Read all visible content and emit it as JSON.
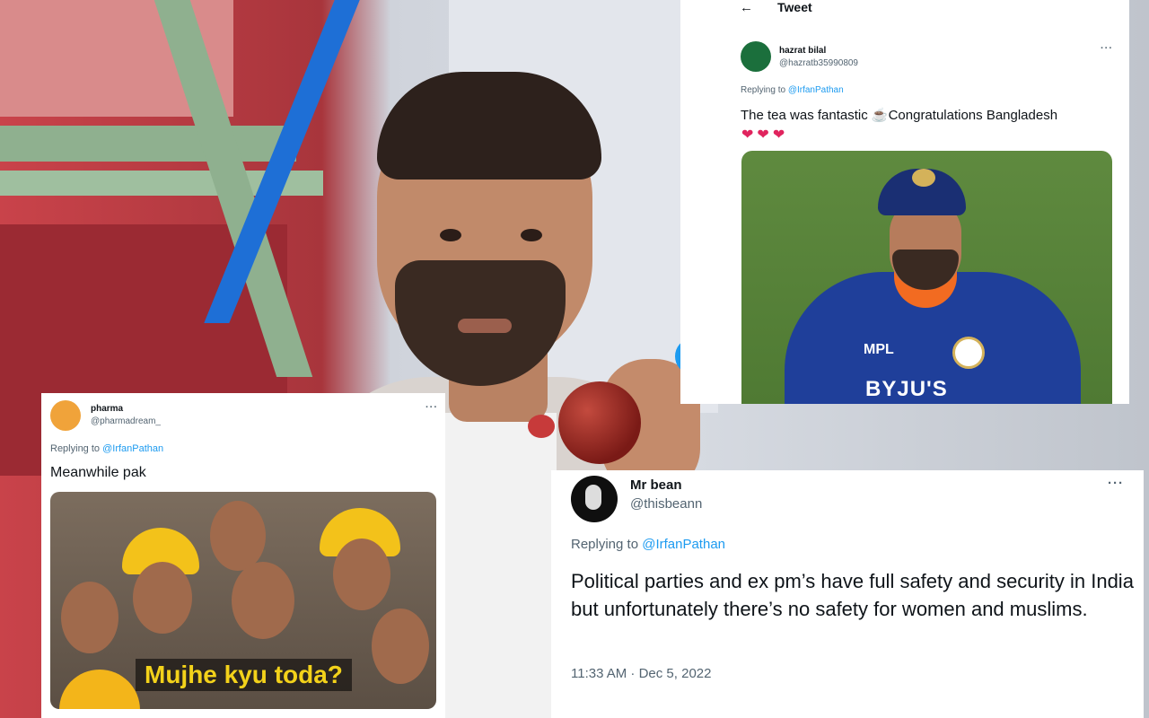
{
  "tweet_top": {
    "back_arrow": "←",
    "header_title": "Tweet",
    "user_name": "hazrat bilal",
    "user_handle": "@hazratb35990809",
    "more": "···",
    "replying_prefix": "Replying to ",
    "replying_mention": "@IrfanPathan",
    "text": "The tea was fantastic ☕Congratulations Bangladesh",
    "hearts": "❤❤❤",
    "media_sponsor_1": "MPL",
    "media_sponsor_2": "BYJU'S"
  },
  "tweet_left": {
    "user_name": "pharma",
    "user_handle": "@pharmadream_",
    "more": "···",
    "replying_prefix": "Replying to ",
    "replying_mention": "@IrfanPathan",
    "text": "Meanwhile pak",
    "media_caption": "Mujhe kyu toda?"
  },
  "tweet_right": {
    "user_name": "Mr bean",
    "user_handle": "@thisbeann",
    "more": "···",
    "replying_prefix": "Replying to ",
    "replying_mention": "@IrfanPathan",
    "text": "Political parties and ex pm’s have full safety and security in India but unfortunately there’s no safety for women and muslims.",
    "timestamp": "11:33 AM · Dec 5, 2022"
  },
  "colors": {
    "link": "#1d9bf0",
    "muted": "#536471",
    "text": "#0f1419",
    "heart": "#e0245e"
  }
}
